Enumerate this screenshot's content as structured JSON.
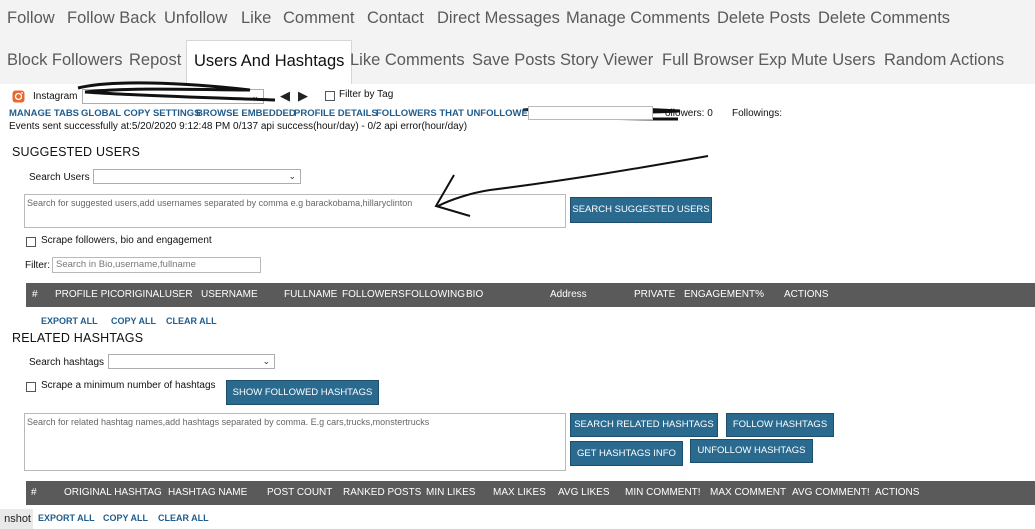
{
  "tabs_row1": [
    "Follow",
    "Follow Back",
    "Unfollow",
    "Like",
    "Comment",
    "Contact",
    "Direct Messages",
    "Manage Comments",
    "Delete Posts",
    "Delete Comments"
  ],
  "tabs_row2": [
    "Block Followers",
    "Repost",
    "Users And Hashtags",
    "Like Comments",
    "Save Posts",
    "Story Viewer",
    "Full Browser Exp",
    "Mute Users",
    "Random Actions"
  ],
  "active_tab": "Users And Hashtags",
  "account": {
    "platform_label": "Instagram",
    "filter_by_tag": "Filter by Tag"
  },
  "links": [
    "MANAGE TABS",
    "GLOBAL COPY SETTINGS",
    "BROWSE EMBEDDED",
    "PROFILE DETAILS",
    "FOLLOWERS THAT UNFOLLOWED"
  ],
  "stats": {
    "followers": "ollowers: 0",
    "followings": "Followings:"
  },
  "status_line": "Events sent successfully at:5/20/2020 9:12:48 PM 0/137 api success(hour/day) -  0/2 api error(hour/day)",
  "suggested": {
    "title": "SUGGESTED USERS",
    "search_label": "Search Users",
    "textarea_placeholder": "Search for suggested users,add usernames separated by comma e.g barackobama,hillaryclinton",
    "search_button": "SEARCH SUGGESTED USERS",
    "scrape_checkbox": "Scrape followers, bio and engagement",
    "filter_label": "Filter:",
    "filter_placeholder": "Search in Bio,username,fullname",
    "columns": [
      "#",
      "PROFILE PIC",
      "ORIGINALUSER",
      "USERNAME",
      "FULLNAME",
      "FOLLOWERS",
      "FOLLOWING",
      "BIO",
      "Address",
      "PRIVATE",
      "ENGAGEMENT%",
      "ACTIONS"
    ],
    "actions": [
      "EXPORT ALL",
      "COPY ALL",
      "CLEAR ALL"
    ]
  },
  "hashtags": {
    "title": "RELATED HASHTAGS",
    "search_label": "Search hashtags",
    "scrape_checkbox": "Scrape a minimum number of hashtags",
    "show_followed_button": "SHOW FOLLOWED HASHTAGS",
    "textarea_placeholder": "Search for related hashtag names,add hashtags separated by comma. E.g cars,trucks,monstertrucks",
    "buttons": [
      "SEARCH RELATED HASHTAGS",
      "FOLLOW HASHTAGS",
      "GET HASHTAGS INFO",
      "UNFOLLOW HASHTAGS"
    ],
    "columns": [
      "#",
      "ORIGINAL HASHTAG",
      "HASHTAG NAME",
      "POST COUNT",
      "RANKED POSTS",
      "MIN LIKES",
      "MAX LIKES",
      "AVG LIKES",
      "MIN COMMENT!",
      "MAX COMMENT",
      "AVG COMMENT!",
      "ACTIONS"
    ],
    "actions": [
      "EXPORT ALL",
      "COPY ALL",
      "CLEAR ALL"
    ]
  },
  "taskbar_fragment": "nshot",
  "icons": [
    "instagram-icon",
    "play-icon",
    "chevron-down-icon"
  ],
  "colors": {
    "accent": "#2b6a8f",
    "header_bar": "#5a5a5a",
    "link": "#1f5d8e"
  }
}
